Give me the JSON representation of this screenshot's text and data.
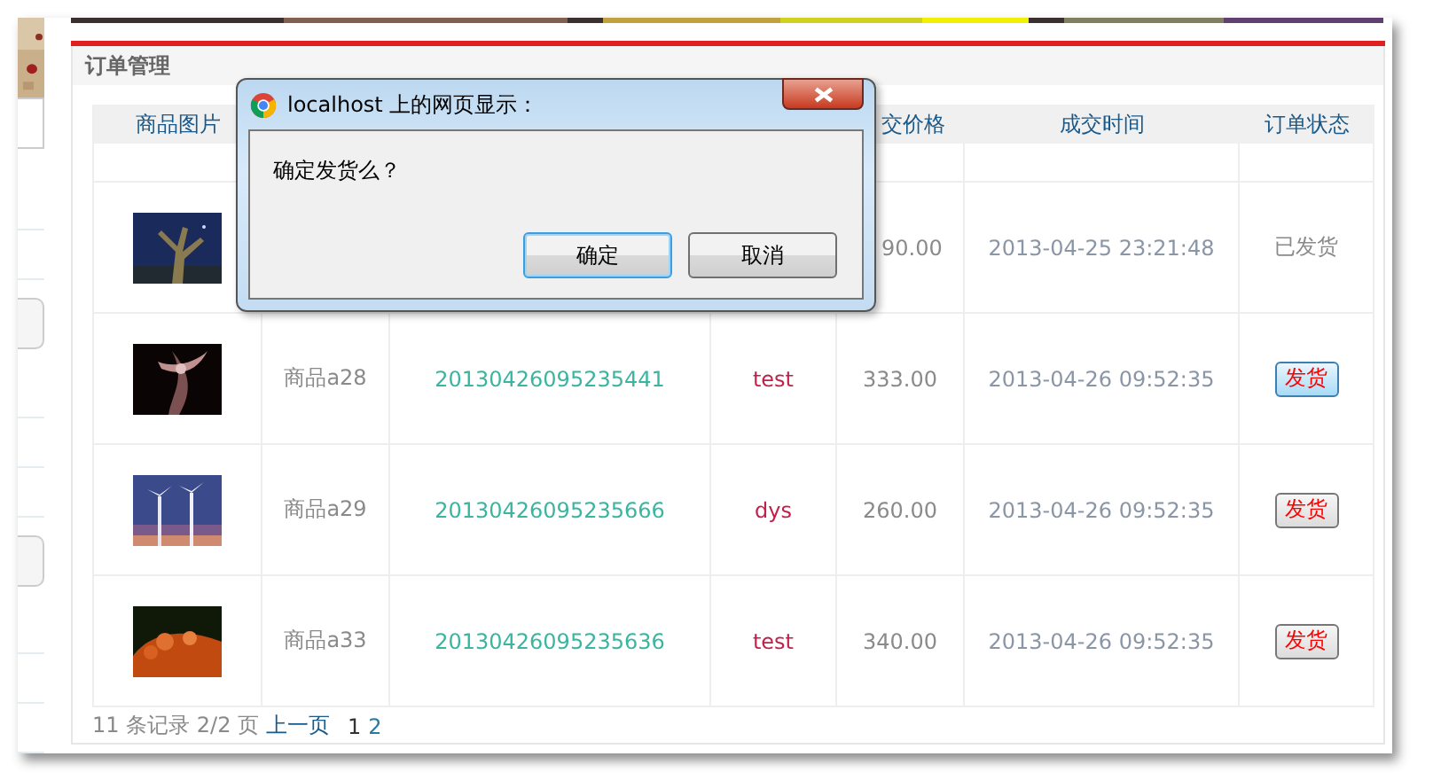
{
  "panel": {
    "title": "订单管理"
  },
  "table": {
    "columns": [
      {
        "label": "商品图片"
      },
      {},
      {},
      {},
      {
        "label": "交价格"
      },
      {
        "label": "成交时间"
      },
      {
        "label": "订单状态"
      }
    ],
    "rows": [
      {
        "price": "90.00",
        "time": "2013-04-25 23:21:48",
        "status": {
          "kind": "text",
          "label": "已发货"
        }
      },
      {
        "name": "商品a28",
        "order_no": "20130426095235441",
        "buyer": "test",
        "price": "333.00",
        "time": "2013-04-26 09:52:35",
        "status": {
          "kind": "button",
          "label": "发货",
          "highlighted": true
        }
      },
      {
        "name": "商品a29",
        "order_no": "20130426095235666",
        "buyer": "dys",
        "price": "260.00",
        "time": "2013-04-26 09:52:35",
        "status": {
          "kind": "button",
          "label": "发货",
          "highlighted": false
        }
      },
      {
        "name": "商品a33",
        "order_no": "20130426095235636",
        "buyer": "test",
        "price": "340.00",
        "time": "2013-04-26 09:52:35",
        "status": {
          "kind": "button",
          "label": "发货",
          "highlighted": false
        }
      }
    ]
  },
  "pagination": {
    "summary": "11 条记录 2/2 页",
    "previous": "上一页",
    "pages": [
      {
        "label": "1",
        "selected": true
      },
      {
        "label": "2",
        "selected": false
      }
    ]
  },
  "dialog": {
    "title": "localhost 上的网页显示：",
    "message": "确定发货么？",
    "buttons": [
      {
        "label": "确定",
        "focused": true
      },
      {
        "label": "取消",
        "focused": false
      }
    ]
  }
}
